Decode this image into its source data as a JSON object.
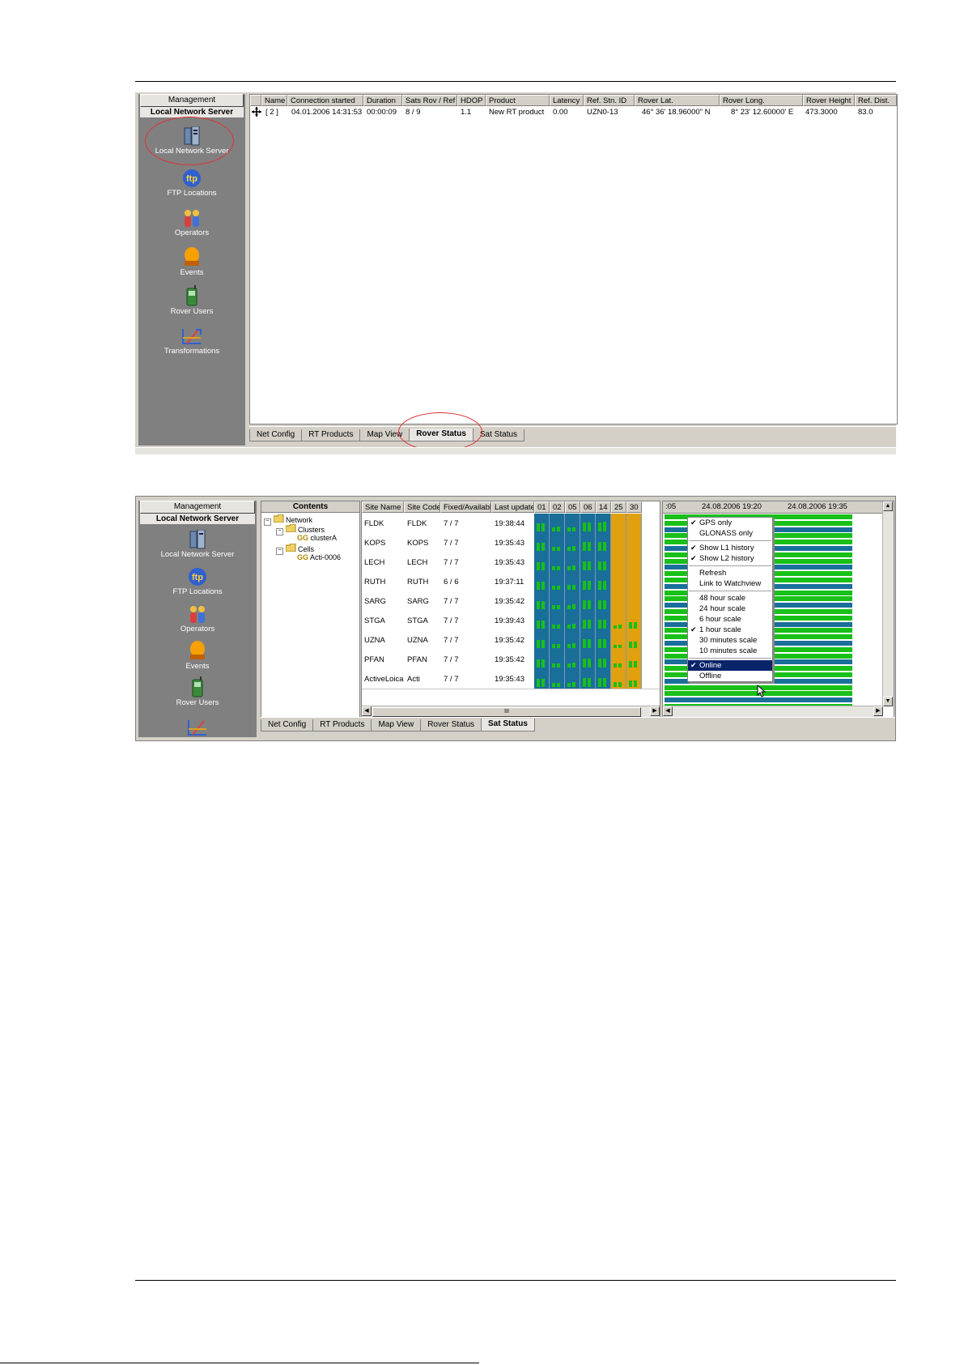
{
  "management": {
    "header": "Management",
    "server_title": "Local Network Server",
    "items": [
      {
        "label": "Local Network Server",
        "icon": "server-icon"
      },
      {
        "label": "FTP Locations",
        "icon": "ftp-icon"
      },
      {
        "label": "Operators",
        "icon": "operators-icon"
      },
      {
        "label": "Events",
        "icon": "events-icon"
      },
      {
        "label": "Rover Users",
        "icon": "rover-users-icon"
      },
      {
        "label": "Transformations",
        "icon": "transformations-icon"
      }
    ]
  },
  "rover_table": {
    "columns": [
      "Name",
      "Connection started",
      "Duration",
      "Sats Rov / Ref",
      "HDOP",
      "Product",
      "Latency",
      "Ref. Stn. ID",
      "Rover Lat.",
      "Rover Long.",
      "Rover Height",
      "Ref. Dist."
    ],
    "rows": [
      {
        "name": "[ 2 ]",
        "connection_started": "04.01.2006 14:31:53",
        "duration": "00:00:09",
        "sats": "8 / 9",
        "hdop": "1.1",
        "product": "New RT product",
        "latency": "0.00",
        "ref_stn": "UZN0-13",
        "lat": "46° 36' 18.96000\" N",
        "long": "8° 23' 12.60000' E",
        "height": "473.3000",
        "dist": "83.0"
      }
    ]
  },
  "tabs_1": {
    "items": [
      "Net Config",
      "RT Products",
      "Map View",
      "Rover Status",
      "Sat Status"
    ],
    "active": "Rover Status"
  },
  "contents": {
    "title": "Contents",
    "tree": {
      "network": "Network",
      "clusters": "Clusters",
      "cluster_a": "clusterA",
      "cells": "Cells",
      "cell_1": "Acti-0006",
      "gg": "GG"
    }
  },
  "sat_table": {
    "columns": [
      "Site Name",
      "Site Code",
      "Fixed/Available",
      "Last update"
    ],
    "prns": [
      "01",
      "02",
      "05",
      "06",
      "14",
      "25",
      "30"
    ],
    "rows": [
      {
        "name": "FLDK",
        "code": "FLDK",
        "fixed": "7 / 7",
        "update": "19:38:44",
        "bars": [
          [
            0.5,
            0.5
          ],
          [
            0.25,
            0.3
          ],
          [
            0.25,
            0.25
          ],
          [
            0.55,
            0.55
          ],
          [
            0.55,
            0.6
          ],
          [],
          []
        ]
      },
      {
        "name": "KOPS",
        "code": "KOPS",
        "fixed": "7 / 7",
        "update": "19:35:43",
        "bars": [
          [
            0.5,
            0.5
          ],
          [
            0.25,
            0.25
          ],
          [
            0.25,
            0.3
          ],
          [
            0.55,
            0.55
          ],
          [
            0.55,
            0.55
          ],
          [],
          []
        ]
      },
      {
        "name": "LECH",
        "code": "LECH",
        "fixed": "7 / 7",
        "update": "19:35:43",
        "bars": [
          [
            0.5,
            0.5
          ],
          [
            0.25,
            0.25
          ],
          [
            0.25,
            0.3
          ],
          [
            0.55,
            0.55
          ],
          [
            0.55,
            0.55
          ],
          [],
          []
        ]
      },
      {
        "name": "RUTH",
        "code": "RUTH",
        "fixed": "6 / 6",
        "update": "19:37:11",
        "bars": [
          [
            0.5,
            0.5
          ],
          [
            0.25,
            0.25
          ],
          [
            0.3,
            0.3
          ],
          [
            0.55,
            0.55
          ],
          [
            0.55,
            0.55
          ],
          [],
          []
        ]
      },
      {
        "name": "SARG",
        "code": "SARG",
        "fixed": "7 / 7",
        "update": "19:35:42",
        "bars": [
          [
            0.5,
            0.5
          ],
          [
            0.25,
            0.25
          ],
          [
            0.25,
            0.3
          ],
          [
            0.55,
            0.55
          ],
          [
            0.55,
            0.55
          ],
          [],
          []
        ]
      },
      {
        "name": "STGA",
        "code": "STGA",
        "fixed": "7 / 7",
        "update": "19:39:43",
        "bars": [
          [
            0.5,
            0.5
          ],
          [
            0.25,
            0.25
          ],
          [
            0.25,
            0.3
          ],
          [
            0.55,
            0.55
          ],
          [
            0.55,
            0.55
          ],
          [
            0.2,
            0.25
          ],
          [
            0.4,
            0.4
          ]
        ]
      },
      {
        "name": "UZNA",
        "code": "UZNA",
        "fixed": "7 / 7",
        "update": "19:35:42",
        "bars": [
          [
            0.5,
            0.5
          ],
          [
            0.25,
            0.25
          ],
          [
            0.25,
            0.3
          ],
          [
            0.55,
            0.55
          ],
          [
            0.55,
            0.55
          ],
          [
            0.2,
            0.2
          ],
          [
            0.4,
            0.4
          ]
        ]
      },
      {
        "name": "PFAN",
        "code": "PFAN",
        "fixed": "7 / 7",
        "update": "19:35:42",
        "bars": [
          [
            0.5,
            0.5
          ],
          [
            0.25,
            0.25
          ],
          [
            0.25,
            0.3
          ],
          [
            0.55,
            0.55
          ],
          [
            0.55,
            0.55
          ],
          [
            0.25,
            0.25
          ],
          [
            0.4,
            0.4
          ]
        ]
      },
      {
        "name": "ActiveLoica",
        "code": "Acti",
        "fixed": "7 / 7",
        "update": "19:35:43",
        "bars": [
          [
            0.5,
            0.5
          ],
          [
            0.25,
            0.25
          ],
          [
            0.25,
            0.3
          ],
          [
            0.55,
            0.55
          ],
          [
            0.55,
            0.55
          ],
          [
            0.3,
            0.3
          ],
          [
            0.4,
            0.4
          ]
        ]
      }
    ]
  },
  "timeline": {
    "label_left": ":05",
    "label_mid": "24.08.2006 19:20",
    "label_right": "24.08.2006 19:35"
  },
  "context_menu": {
    "items": [
      {
        "label": "GPS only",
        "checked": true
      },
      {
        "label": "GLONASS only",
        "checked": false
      },
      {
        "sep": true
      },
      {
        "label": "Show L1 history",
        "checked": true
      },
      {
        "label": "Show L2 history",
        "checked": true
      },
      {
        "sep": true
      },
      {
        "label": "Refresh",
        "checked": false
      },
      {
        "label": "Link to Watchview",
        "checked": false
      },
      {
        "sep": true
      },
      {
        "label": "48 hour scale",
        "checked": false
      },
      {
        "label": "24 hour scale",
        "checked": false
      },
      {
        "label": "6 hour scale",
        "checked": false
      },
      {
        "label": "1 hour scale",
        "checked": true
      },
      {
        "label": "30 minutes scale",
        "checked": false
      },
      {
        "label": "10 minutes scale",
        "checked": false
      },
      {
        "sep": true
      },
      {
        "label": "Online",
        "checked": true,
        "selected": true
      },
      {
        "label": "Offline",
        "checked": false
      }
    ]
  },
  "tabs_2": {
    "items": [
      "Net Config",
      "RT Products",
      "Map View",
      "Rover Status",
      "Sat Status"
    ],
    "active": "Sat Status"
  },
  "scroll": {
    "thumb_glyph": "III"
  },
  "colors": {
    "panel_gray": "#808080",
    "sat_blue": "#1a6f9a",
    "sat_orange": "#e0a010",
    "bar_green": "#18c018",
    "menu_highlight": "#0a246a",
    "annotation_red": "#d33333"
  }
}
